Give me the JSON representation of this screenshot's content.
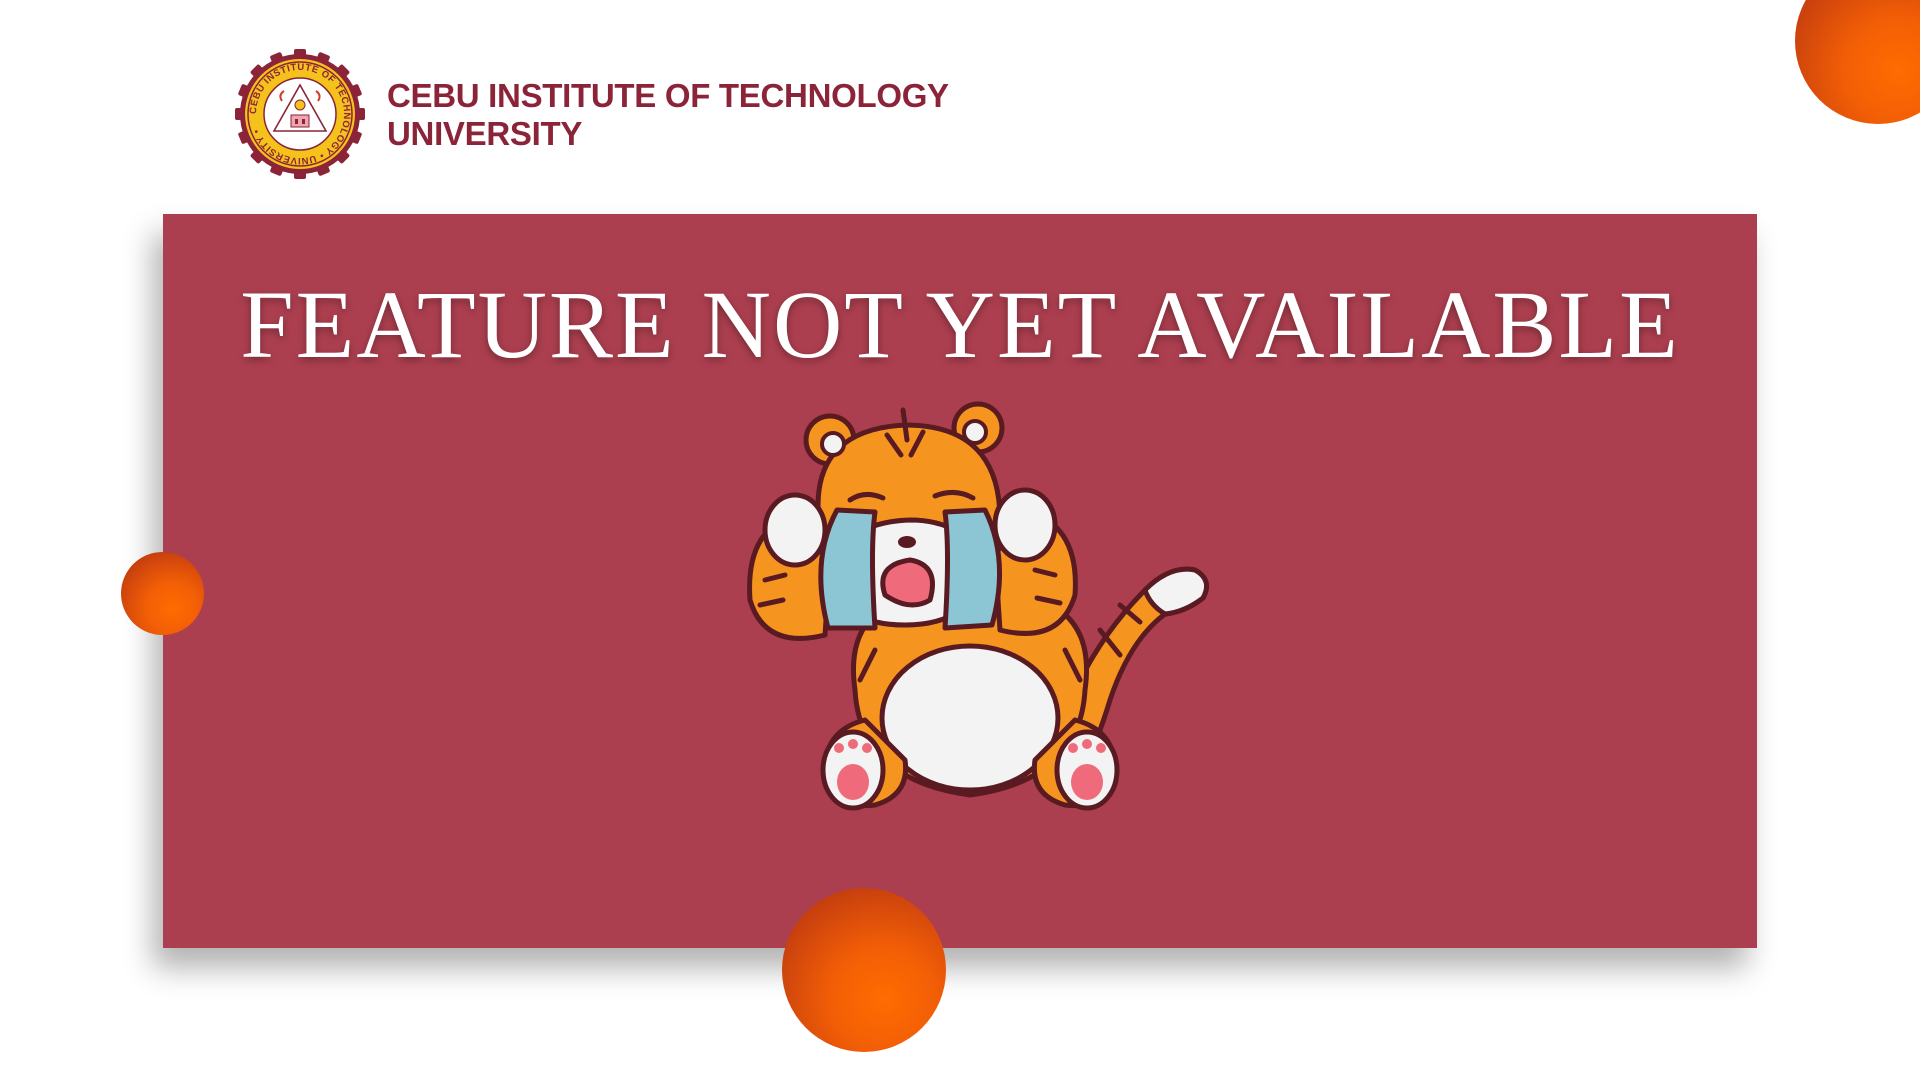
{
  "header": {
    "logo_icon": "cebu-institute-of-technology-university-seal",
    "logo_ring_text": "CEBU INSTITUTE OF TECHNOLOGY • UNIVERSITY •",
    "name_line1": "CEBU INSTITUTE OF TECHNOLOGY",
    "name_line2": "UNIVERSITY"
  },
  "main": {
    "headline": "FEATURE NOT YET AVAILABLE",
    "illustration_icon": "crying-tiger-icon"
  },
  "colors": {
    "brand_maroon": "#8b2439",
    "panel": "#ac3f4f",
    "orb_orange": "#f25e06",
    "background": "#ffffff"
  }
}
